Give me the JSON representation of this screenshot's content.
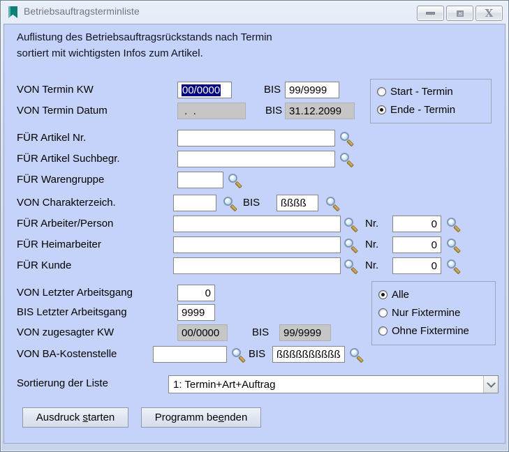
{
  "window": {
    "title": "Betriebsauftragsterminliste",
    "description_line1": "Auflistung des Betriebsauftragsrückstands nach Termin",
    "description_line2": "sortiert mit wichtigsten Infos zum Artikel."
  },
  "colors": {
    "content_background": "#c5d3fa",
    "selection_background": "#000080",
    "disabled_field_background": "#c6c6c6",
    "title_icon_teal": "#0f7e79"
  },
  "icons": {
    "title": "bookmark-icon",
    "field_lookup": "search-icon",
    "dropdown": "chevron-down-icon",
    "window": [
      "minimize-icon",
      "maximize-icon",
      "close-icon"
    ]
  },
  "form": {
    "bis_label": "BIS",
    "nr_label": "Nr.",
    "rows": {
      "termin_kw": {
        "label": "VON Termin KW",
        "von": "00/0000",
        "bis": "99/9999"
      },
      "termin_datum": {
        "label": "VON Termin Datum",
        "von": " .  .",
        "bis": "31.12.2099"
      },
      "artikel_nr": {
        "label": "FÜR Artikel Nr.",
        "value": ""
      },
      "artikel_such": {
        "label": "FÜR Artikel Suchbegr.",
        "value": ""
      },
      "warengruppe": {
        "label": "FÜR Warengruppe",
        "value": ""
      },
      "charakterzeich": {
        "label": "VON Charakterzeich.",
        "von": "",
        "bis": "ßßßß"
      },
      "arbeiter": {
        "label": "FÜR Arbeiter/Person",
        "value": "",
        "nr": "0"
      },
      "heimarbeiter": {
        "label": "FÜR Heimarbeiter",
        "value": "",
        "nr": "0"
      },
      "kunde": {
        "label": "FÜR Kunde",
        "value": "",
        "nr": "0"
      },
      "von_letzter_ag": {
        "label": "VON Letzter Arbeitsgang",
        "value": "0"
      },
      "bis_letzter_ag": {
        "label": "BIS Letzter Arbeitsgang",
        "value": "9999"
      },
      "zugesagte_kw": {
        "label": "VON zugesagter KW",
        "von": "00/0000",
        "bis": "99/9999"
      },
      "ba_kostenstelle": {
        "label": "VON BA-Kostenstelle",
        "von": "",
        "bis": "ßßßßßßßßßß"
      },
      "sortierung": {
        "label": "Sortierung der Liste",
        "value": "1: Termin+Art+Auftrag"
      }
    },
    "radio_termin": {
      "options": [
        "Start - Termin",
        "Ende - Termin"
      ],
      "selected": "Ende - Termin"
    },
    "radio_fixtermine": {
      "options": [
        "Alle",
        "Nur Fixtermine",
        "Ohne Fixtermine"
      ],
      "selected": "Alle"
    },
    "buttons": {
      "print": {
        "pre": "Ausdruck ",
        "accel": "s",
        "post": "tarten"
      },
      "exit": {
        "pre": "Programm be",
        "accel": "e",
        "post": "nden"
      }
    }
  }
}
